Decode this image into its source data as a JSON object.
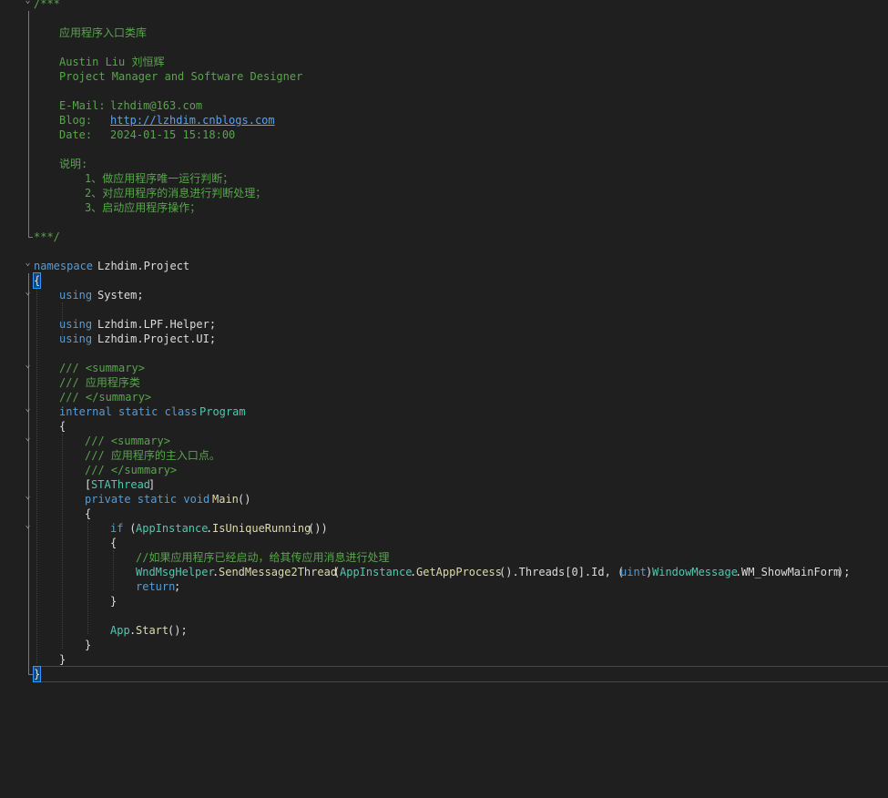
{
  "editor": {
    "header_comment": {
      "open": "/***",
      "title": "应用程序入口类库",
      "author": "Austin Liu 刘恒辉",
      "role": "Project Manager and Software Designer",
      "email_label": "E-Mail:",
      "email": "lzhdim@163.com",
      "blog_label": "Blog:",
      "blog_url": "http://lzhdim.cnblogs.com",
      "date_label": "Date:",
      "date": "2024-01-15 15:18:00",
      "notes_label": "说明:",
      "note1": "1、做应用程序唯一运行判断；",
      "note2": "2、对应用程序的消息进行判断处理；",
      "note3": "3、启动应用程序操作；",
      "close": "***/"
    },
    "code": {
      "kw_namespace": "namespace",
      "namespace_name": "Lzhdim.Project",
      "open_brace": "{",
      "close_brace": "}",
      "kw_using": "using",
      "using1": "System;",
      "using2": "Lzhdim.LPF.Helper;",
      "using3": "Lzhdim.Project.UI;",
      "doc_summary_open": "/// <summary>",
      "doc_class": "/// 应用程序类",
      "doc_summary_close": "/// </summary>",
      "kw_internal_static_class": "internal static class",
      "class_name": "Program",
      "doc_main": "/// 应用程序的主入口点。",
      "attr_open": "[",
      "attr_name": "STAThread",
      "attr_close": "]",
      "kw_private_static_void": "private static void",
      "method_name": "Main",
      "method_parens": "()",
      "kw_if": "if",
      "if_open": " (",
      "class_appinstance": "AppInstance",
      "dot": ".",
      "fn_isunique": "IsUniqueRunning",
      "if_close": "())",
      "comment_running": "//如果应用程序已经启动，给其传应用消息进行处理",
      "class_wndmsghelper": "WndMsgHelper",
      "fn_sendmsg": "SendMessage2Thread",
      "paren_open": "(",
      "fn_getappprocess": "GetAppProcess",
      "threads_part": "().Threads[0].Id, (",
      "kw_uint": "uint",
      "cast_close": ")",
      "enum_windowmessage": "WindowMessage",
      "enum_value": "WM_ShowMainForm",
      "stmt_end": ");",
      "kw_return": "return",
      "semicolon": ";",
      "class_app": "App",
      "fn_start": "Start",
      "call_end": "();"
    }
  },
  "colors": {
    "background": "#1f1f1f",
    "comment": "#57a64a",
    "keyword": "#569cd6",
    "type": "#4ec9b0",
    "method": "#dcdcaa",
    "plain": "#dcdcdc",
    "link": "#5ba0f2"
  },
  "icons": {
    "fold": "chevron-down-icon"
  }
}
